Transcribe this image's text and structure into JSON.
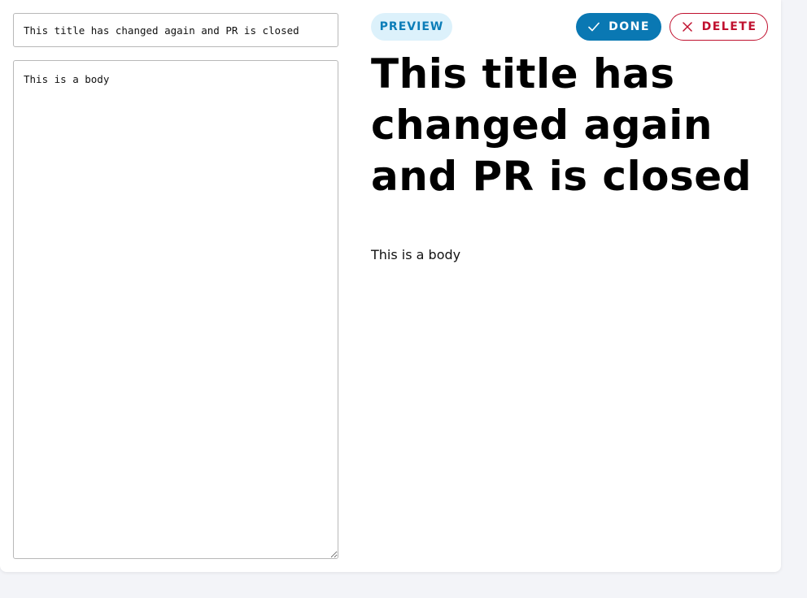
{
  "editor": {
    "title_value": "This title has changed again and PR is closed",
    "body_value": "This is a body"
  },
  "toolbar": {
    "preview_label": "PREVIEW",
    "done_label": "DONE",
    "delete_label": "DELETE",
    "done_icon": "check-icon",
    "delete_icon": "close-icon"
  },
  "preview": {
    "title": "This title has changed again and PR is closed",
    "body": "This is a body"
  },
  "colors": {
    "primary": "#0a78b3",
    "preview_bg": "#dcf1fb",
    "danger": "#c0102e",
    "page_bg": "#f3f4f8"
  }
}
